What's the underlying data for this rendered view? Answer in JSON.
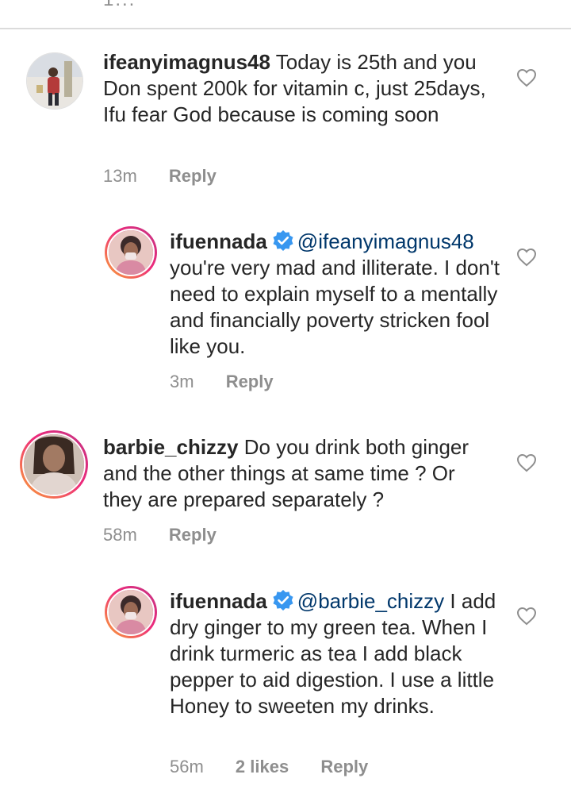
{
  "colors": {
    "text": "#262626",
    "muted": "#8e8e8e",
    "mention": "#00376b",
    "verified_badge": "#3897f0",
    "divider": "#dbdbdb"
  },
  "top_cut_text": "1...",
  "comments": [
    {
      "username": "ifeanyimagnus48",
      "text": "Today is 25th and you Don spent 200k for vitamin c, just 25days, Ifu fear God because is coming soon",
      "time": "13m",
      "reply_label": "Reply",
      "like_icon": "heart-outline-icon"
    },
    {
      "username": "ifuennada",
      "verified": true,
      "mention": "@ifeanyimagnus48",
      "text": "you're very mad and illiterate. I don't need to explain myself to a mentally and financially poverty stricken fool like you.",
      "time": "3m",
      "reply_label": "Reply",
      "like_icon": "heart-outline-icon"
    },
    {
      "username": "barbie_chizzy",
      "text": "Do you drink both ginger and the other things at same time ? Or they are prepared separately ?",
      "time": "58m",
      "reply_label": "Reply",
      "like_icon": "heart-outline-icon"
    },
    {
      "username": "ifuennada",
      "verified": true,
      "mention": "@barbie_chizzy",
      "text": "I add dry ginger to my green tea. When I drink turmeric as tea I add black pepper to aid digestion. I use a little Honey to sweeten my drinks.",
      "time": "56m",
      "likes": "2 likes",
      "reply_label": "Reply",
      "like_icon": "heart-outline-icon"
    }
  ]
}
